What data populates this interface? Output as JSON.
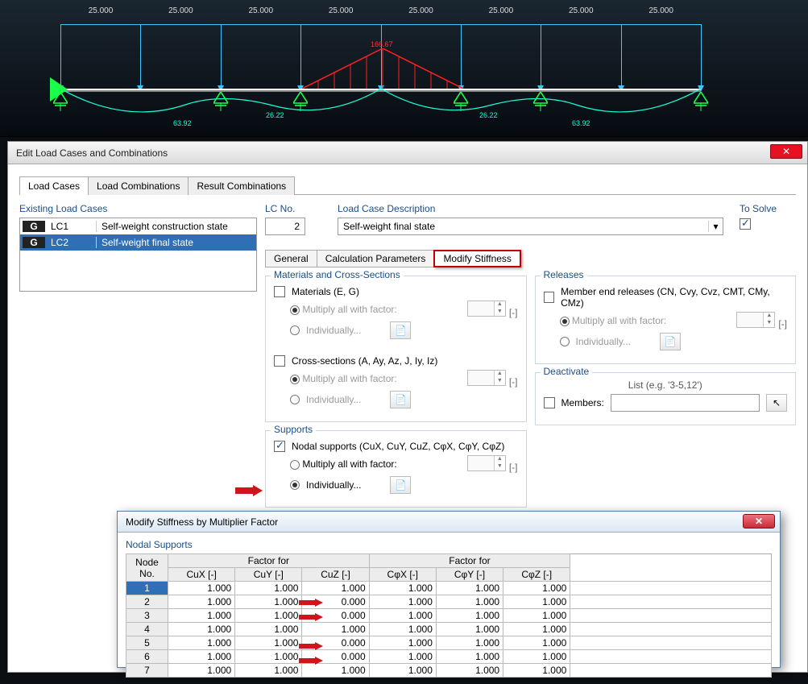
{
  "beam": {
    "span_labels": [
      "25.000",
      "25.000",
      "25.000",
      "25.000",
      "25.000",
      "25.000",
      "25.000",
      "25.000"
    ],
    "peak_label": "166.67",
    "curve_labels": [
      "63.92",
      "26.22",
      "26.22",
      "63.92"
    ]
  },
  "window": {
    "title": "Edit Load Cases and Combinations",
    "tabs": [
      "Load Cases",
      "Load Combinations",
      "Result Combinations"
    ],
    "active_tab": 0
  },
  "existing": {
    "label": "Existing Load Cases",
    "items": [
      {
        "badge": "G",
        "code": "LC1",
        "desc": "Self-weight construction state",
        "selected": false
      },
      {
        "badge": "G",
        "code": "LC2",
        "desc": "Self-weight final state",
        "selected": true
      }
    ]
  },
  "top_fields": {
    "lc_no_label": "LC No.",
    "lc_no_value": "2",
    "desc_label": "Load Case Description",
    "desc_value": "Self-weight final state",
    "solve_label": "To Solve",
    "solve_checked": true
  },
  "subtabs": [
    "General",
    "Calculation Parameters",
    "Modify Stiffness"
  ],
  "materials": {
    "legend": "Materials and Cross-Sections",
    "materials_chk": "Materials (E, G)",
    "mult_label": "Multiply all with factor:",
    "indiv_label": "Individually...",
    "cross_chk": "Cross-sections (A, Ay, Az, J, Iy, Iz)",
    "unit": "[-]"
  },
  "releases": {
    "legend": "Releases",
    "chk": "Member end releases (CN, Cvy, Cvz, CMT, CMy, CMz)",
    "mult_label": "Multiply all with factor:",
    "indiv_label": "Individually...",
    "unit": "[-]"
  },
  "deactivate": {
    "legend": "Deactivate",
    "hint": "List (e.g. '3-5,12')",
    "members_label": "Members:"
  },
  "supports": {
    "legend": "Supports",
    "chk": "Nodal supports (CuX, CuY, CuZ, CφX, CφY, CφZ)",
    "mult_label": "Multiply all with factor:",
    "indiv_label": "Individually...",
    "unit": "[-]"
  },
  "subdialog": {
    "title": "Modify Stiffness by Multiplier Factor",
    "group": "Nodal Supports",
    "node_hdr": "Node No.",
    "factor_for": "Factor for",
    "cols": [
      "CuX [-]",
      "CuY [-]",
      "CuZ [-]",
      "CφX [-]",
      "CφY [-]",
      "CφZ [-]"
    ],
    "rows": [
      {
        "n": "1",
        "v": [
          "1.000",
          "1.000",
          "1.000",
          "1.000",
          "1.000",
          "1.000"
        ],
        "sel": true,
        "arrow": false
      },
      {
        "n": "2",
        "v": [
          "1.000",
          "1.000",
          "0.000",
          "1.000",
          "1.000",
          "1.000"
        ],
        "sel": false,
        "arrow": true
      },
      {
        "n": "3",
        "v": [
          "1.000",
          "1.000",
          "0.000",
          "1.000",
          "1.000",
          "1.000"
        ],
        "sel": false,
        "arrow": true
      },
      {
        "n": "4",
        "v": [
          "1.000",
          "1.000",
          "1.000",
          "1.000",
          "1.000",
          "1.000"
        ],
        "sel": false,
        "arrow": false
      },
      {
        "n": "5",
        "v": [
          "1.000",
          "1.000",
          "0.000",
          "1.000",
          "1.000",
          "1.000"
        ],
        "sel": false,
        "arrow": true
      },
      {
        "n": "6",
        "v": [
          "1.000",
          "1.000",
          "0.000",
          "1.000",
          "1.000",
          "1.000"
        ],
        "sel": false,
        "arrow": true
      },
      {
        "n": "7",
        "v": [
          "1.000",
          "1.000",
          "1.000",
          "1.000",
          "1.000",
          "1.000"
        ],
        "sel": false,
        "arrow": false
      }
    ]
  }
}
